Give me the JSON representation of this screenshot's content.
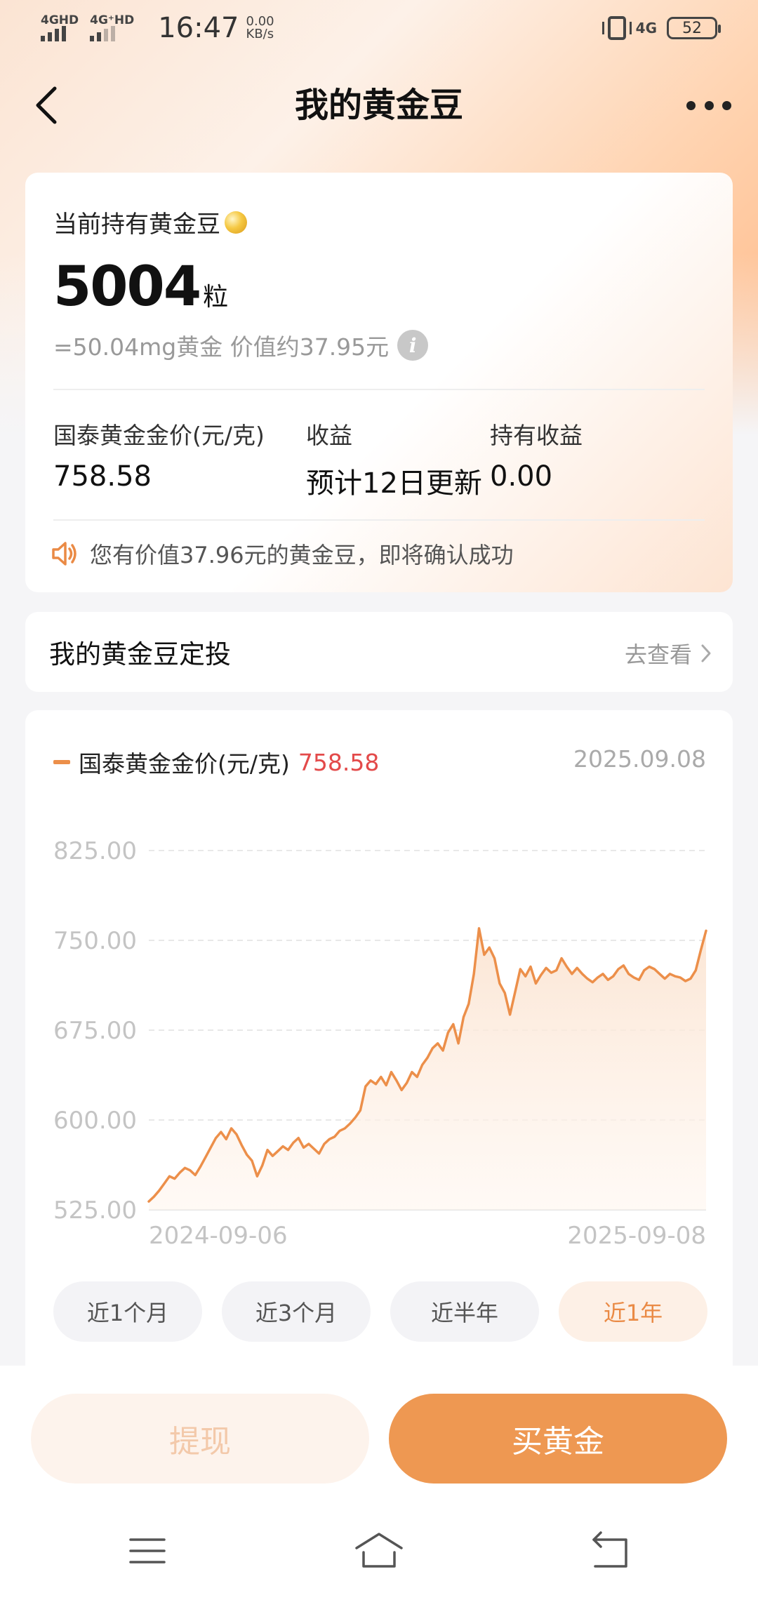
{
  "status_bar": {
    "signal1": "4GHD",
    "signal2": "4G⁺HD",
    "time": "16:47",
    "speed_value": "0.00",
    "speed_unit": "KB/s",
    "network": "4G",
    "battery": "52"
  },
  "nav": {
    "title": "我的黄金豆"
  },
  "holding": {
    "label": "当前持有黄金豆",
    "count": "5004",
    "unit": "粒",
    "equivalent": "=50.04mg黄金 价值约37.95元",
    "stats": [
      {
        "label": "国泰黄金金价(元/克)",
        "value": "758.58"
      },
      {
        "label": "收益",
        "value": "预计12日更新"
      },
      {
        "label": "持有收益",
        "value": "0.00"
      }
    ],
    "notice": "您有价值37.96元的黄金豆，即将确认成功"
  },
  "plan": {
    "title": "我的黄金豆定投",
    "link": "去查看"
  },
  "chart": {
    "legend": "国泰黄金金价(元/克)",
    "current_value": "758.58",
    "date": "2025.09.08",
    "ranges": [
      "近1个月",
      "近3个月",
      "近半年",
      "近1年"
    ],
    "active_range": 3
  },
  "chart_data": {
    "type": "area",
    "series": [
      {
        "name": "国泰黄金金价(元/克)",
        "color": "#ec8f4a"
      }
    ],
    "x_start": "2024-09-06",
    "x_end": "2025-09-08",
    "x_tick_labels": [
      "2024-09-06",
      "2025-09-08"
    ],
    "y_ticks": [
      "825.00",
      "750.00",
      "675.00",
      "600.00",
      "525.00"
    ],
    "ylim": [
      525,
      825
    ],
    "grid": true,
    "values": [
      532,
      536,
      541,
      547,
      553,
      551,
      556,
      560,
      558,
      554,
      561,
      569,
      577,
      585,
      590,
      584,
      593,
      588,
      579,
      571,
      566,
      553,
      562,
      575,
      570,
      574,
      578,
      575,
      581,
      585,
      577,
      580,
      576,
      572,
      580,
      584,
      586,
      591,
      593,
      597,
      602,
      608,
      628,
      633,
      630,
      636,
      629,
      640,
      633,
      625,
      631,
      640,
      636,
      646,
      652,
      660,
      664,
      658,
      673,
      680,
      664,
      686,
      697,
      722,
      760,
      738,
      744,
      735,
      714,
      706,
      688,
      707,
      726,
      720,
      728,
      714,
      721,
      727,
      723,
      725,
      735,
      728,
      722,
      727,
      722,
      718,
      715,
      719,
      722,
      717,
      720,
      726,
      729,
      722,
      719,
      717,
      725,
      728,
      726,
      722,
      718,
      722,
      720,
      719,
      716,
      718,
      725,
      742,
      758
    ]
  },
  "actions": {
    "withdraw": "提现",
    "buy": "买黄金"
  },
  "colors": {
    "accent": "#ee9852",
    "price_red": "#e34a4a",
    "line": "#ec8f4a"
  }
}
